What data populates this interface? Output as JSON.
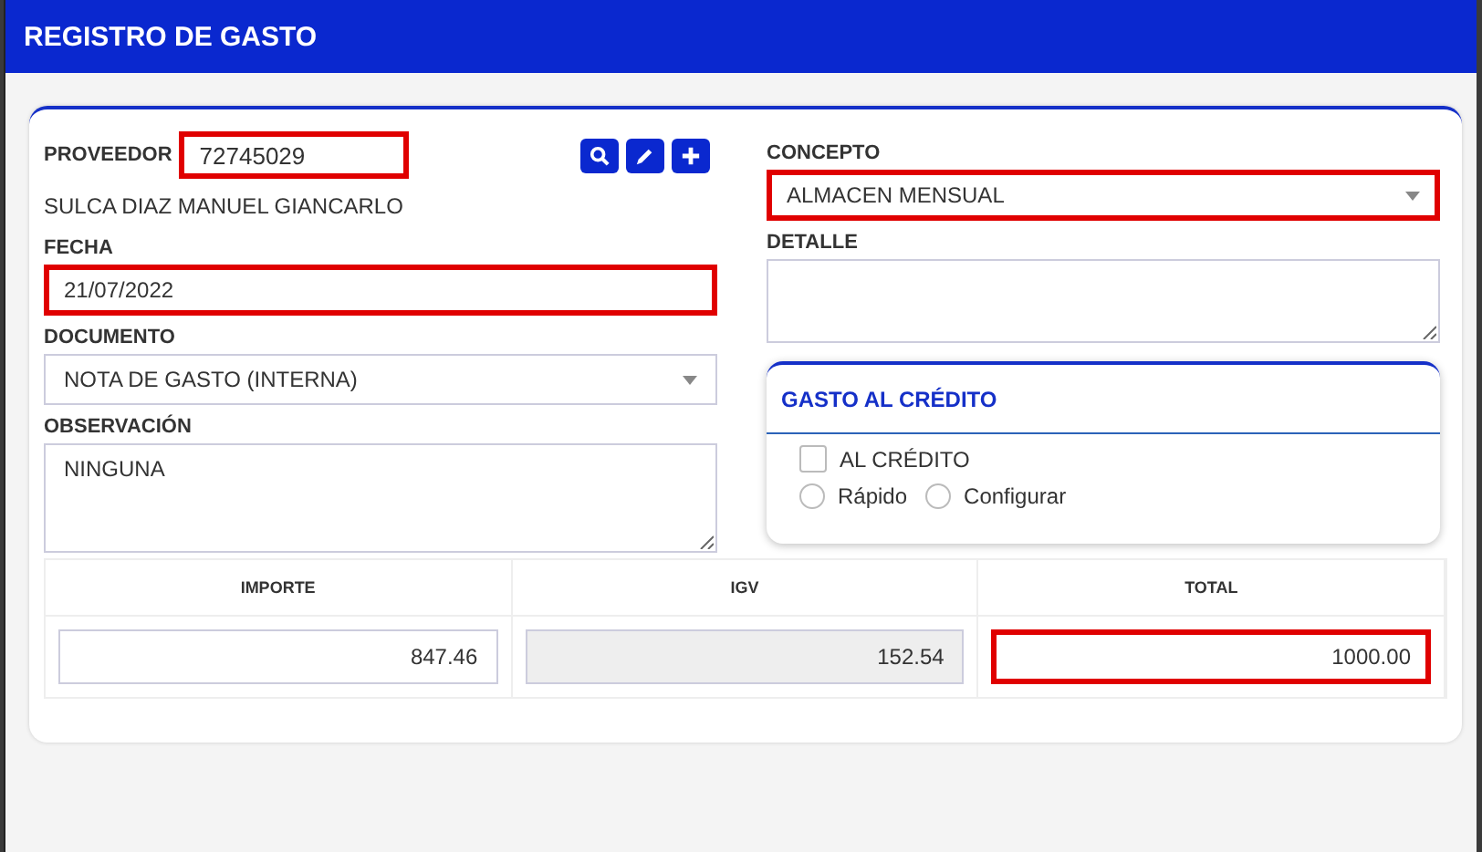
{
  "window": {
    "title": "REGISTRO DE GASTO"
  },
  "proveedor": {
    "label": "PROVEEDOR",
    "value": "72745029",
    "highlighted": true,
    "name": "SULCA DIAZ MANUEL GIANCARLO"
  },
  "left_fields": [
    {
      "kind": "text",
      "label": "FECHA",
      "value": "21/07/2022",
      "highlighted": true
    },
    {
      "kind": "select",
      "label": "DOCUMENTO",
      "value": "NOTA DE GASTO (INTERNA)",
      "highlighted": false
    },
    {
      "kind": "textarea",
      "label": "OBSERVACIÓN",
      "value": "NINGUNA",
      "highlighted": false
    }
  ],
  "right_fields": [
    {
      "kind": "select",
      "label": "CONCEPTO",
      "value": "ALMACEN MENSUAL",
      "highlighted": true
    },
    {
      "kind": "textarea",
      "label": "DETALLE",
      "highlighted": false
    }
  ],
  "credit": {
    "title": "GASTO AL CRÉDITO",
    "checkbox": {
      "label": "AL CRÉDITO",
      "checked": false
    },
    "options": [
      {
        "label": "Rápido",
        "selected": false
      },
      {
        "label": "Configurar",
        "selected": false
      }
    ]
  },
  "amounts": [
    {
      "header": "IMPORTE",
      "value": "847.46",
      "disabled": false,
      "highlighted": false
    },
    {
      "header": "IGV",
      "value": "152.54",
      "disabled": true,
      "highlighted": false
    },
    {
      "header": "TOTAL",
      "value": "1000.00",
      "disabled": false,
      "highlighted": true
    }
  ]
}
